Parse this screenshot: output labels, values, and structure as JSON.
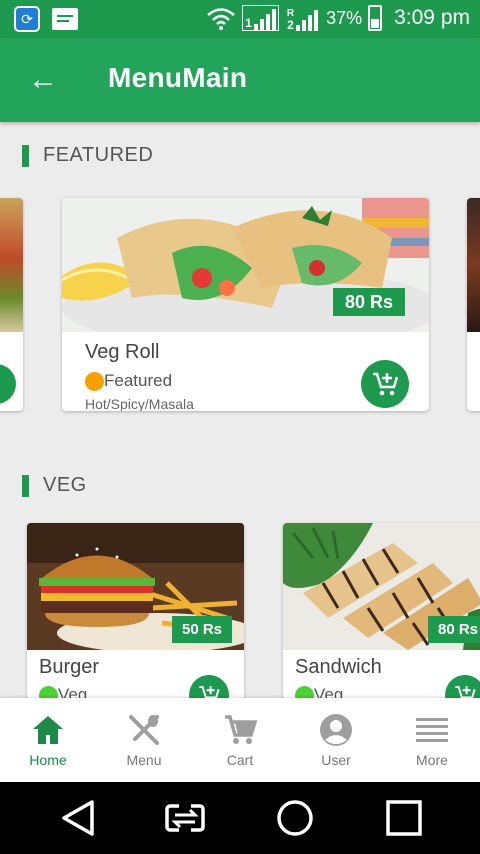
{
  "status_bar": {
    "battery": "37%",
    "time": "3:09 pm",
    "sim1": "1",
    "sim2": "2",
    "roaming": "R"
  },
  "app_bar": {
    "title": "MenuMain",
    "back_icon": "arrow-left-icon"
  },
  "featured": {
    "header": "FEATURED",
    "main_card": {
      "name": "Veg Roll",
      "price": "80 Rs",
      "tag": "Featured",
      "subtag": "Hot/Spicy/Masala"
    }
  },
  "veg": {
    "header": "VEG",
    "items": [
      {
        "name": "Burger",
        "price": "50 Rs",
        "tag": "Veg"
      },
      {
        "name": "Sandwich",
        "price": "80 Rs",
        "tag": "Veg"
      }
    ]
  },
  "bottom_nav": [
    {
      "label": "Home",
      "icon": "home-icon",
      "active": true
    },
    {
      "label": "Menu",
      "icon": "fork-spoon-icon",
      "active": false
    },
    {
      "label": "Cart",
      "icon": "cart-icon",
      "active": false
    },
    {
      "label": "User",
      "icon": "user-icon",
      "active": false
    },
    {
      "label": "More",
      "icon": "menu-lines-icon",
      "active": false
    }
  ],
  "colors": {
    "primary": "#22a55a",
    "status_bar": "#1e9a4f",
    "featured_dot": "#f7a000",
    "veg_dot": "#4cd137",
    "inactive_icon": "#9e9e9e"
  }
}
